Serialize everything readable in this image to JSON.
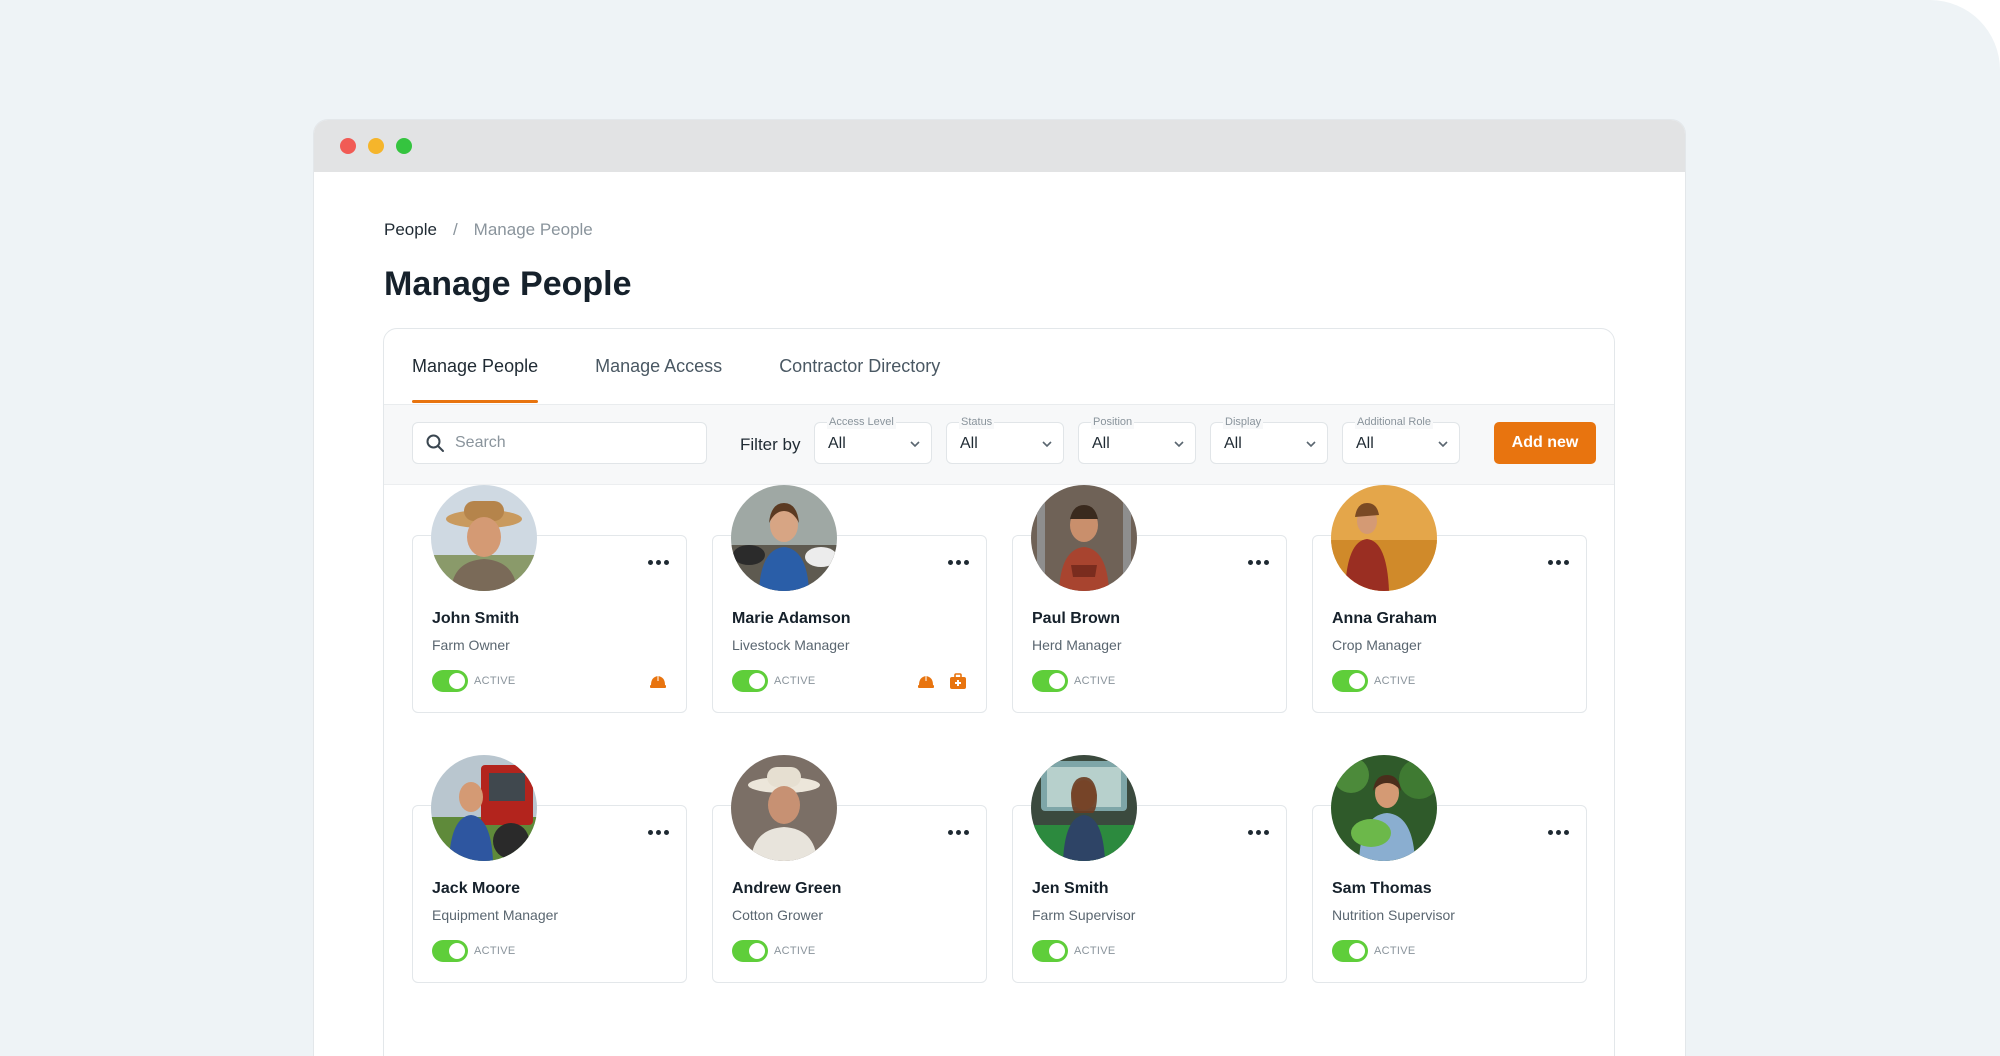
{
  "window": {
    "controls": [
      "close",
      "minimize",
      "maximize"
    ]
  },
  "breadcrumb": {
    "parent": "People",
    "separator": "/",
    "current": "Manage People"
  },
  "page": {
    "title": "Manage People"
  },
  "tabs": [
    {
      "label": "Manage People",
      "active": true
    },
    {
      "label": "Manage Access",
      "active": false
    },
    {
      "label": "Contractor Directory",
      "active": false
    }
  ],
  "toolbar": {
    "search_placeholder": "Search",
    "filter_label": "Filter by",
    "filters": [
      {
        "label": "Access Level",
        "value": "All"
      },
      {
        "label": "Status",
        "value": "All"
      },
      {
        "label": "Position",
        "value": "All"
      },
      {
        "label": "Display",
        "value": "All"
      },
      {
        "label": "Additional Role",
        "value": "All"
      }
    ],
    "add_button": "Add new"
  },
  "colors": {
    "accent": "#e8740f",
    "toggle_on": "#5fce3a"
  },
  "people": [
    {
      "name": "John Smith",
      "role": "Farm Owner",
      "status": "ACTIVE",
      "badges": [
        "hard-hat-icon"
      ]
    },
    {
      "name": "Marie Adamson",
      "role": "Livestock Manager",
      "status": "ACTIVE",
      "badges": [
        "hard-hat-icon",
        "first-aid-kit-icon"
      ]
    },
    {
      "name": "Paul Brown",
      "role": "Herd Manager",
      "status": "ACTIVE",
      "badges": []
    },
    {
      "name": "Anna Graham",
      "role": "Crop Manager",
      "status": "ACTIVE",
      "badges": []
    },
    {
      "name": "Jack Moore",
      "role": "Equipment Manager",
      "status": "ACTIVE",
      "badges": []
    },
    {
      "name": "Andrew Green",
      "role": "Cotton Grower",
      "status": "ACTIVE",
      "badges": []
    },
    {
      "name": "Jen Smith",
      "role": "Farm Supervisor",
      "status": "ACTIVE",
      "badges": []
    },
    {
      "name": "Sam Thomas",
      "role": "Nutrition Supervisor",
      "status": "ACTIVE",
      "badges": []
    }
  ]
}
